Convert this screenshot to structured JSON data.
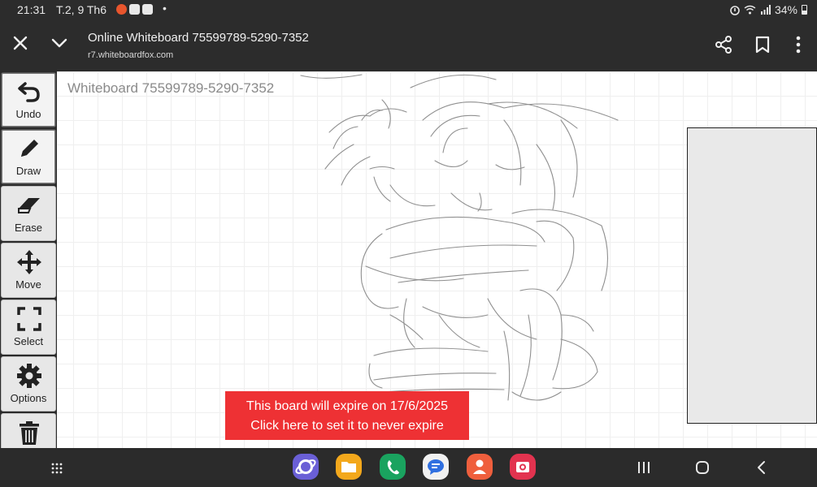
{
  "status_bar": {
    "time": "21:31",
    "date": "T.2, 9 Th6",
    "notification_icons": [
      "circle-app-icon",
      "youtube-icon",
      "facebook-icon"
    ],
    "battery": "34%"
  },
  "app_bar": {
    "title": "Online Whiteboard 75599789-5290-7352",
    "url": "r7.whiteboardfox.com"
  },
  "board": {
    "heading": "Whiteboard 75599789-5290-7352"
  },
  "toolbar": {
    "active_tool": "Draw",
    "tools": [
      {
        "label": "Undo",
        "icon": "undo-icon"
      },
      {
        "label": "Draw",
        "icon": "pencil-icon"
      },
      {
        "label": "Erase",
        "icon": "eraser-icon"
      },
      {
        "label": "Move",
        "icon": "move-arrows-icon"
      },
      {
        "label": "Select",
        "icon": "select-corners-icon"
      },
      {
        "label": "Options",
        "icon": "gear-icon"
      },
      {
        "label": "",
        "icon": "trash-icon"
      }
    ]
  },
  "banner": {
    "line1": "This board will expire on 17/6/2025",
    "line2": "Click here to set it to never expire"
  },
  "colors": {
    "banner_bg": "#ee3134",
    "bar_bg": "#2c2c2c",
    "tool_bg": "#e7e7e7",
    "panel_bg": "#e9e9e9"
  },
  "dock": {
    "apps": [
      {
        "icon": "internet-browser-icon",
        "color": "#6a5fd6"
      },
      {
        "icon": "files-folder-icon",
        "color": "#f3a81c"
      },
      {
        "icon": "phone-icon",
        "color": "#1aa35f"
      },
      {
        "icon": "messages-icon",
        "color": "#f1f1f1"
      },
      {
        "icon": "contacts-icon",
        "color": "#ef5f3d"
      },
      {
        "icon": "camera-icon",
        "color": "#e2334f"
      }
    ]
  }
}
